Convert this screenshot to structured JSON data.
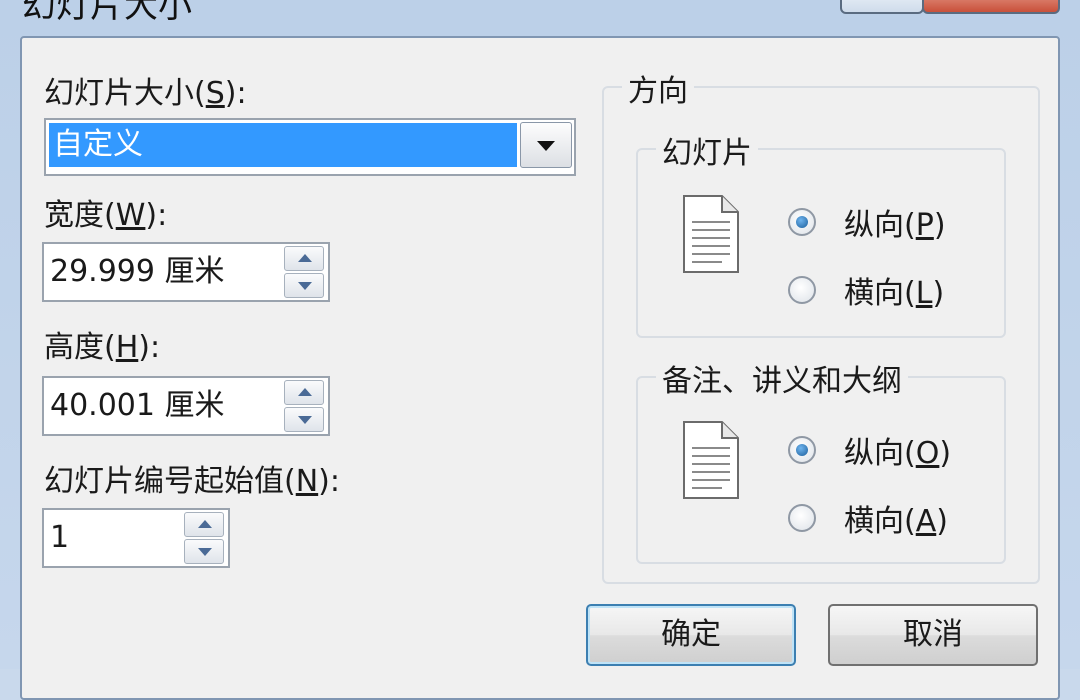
{
  "window": {
    "title": "幻灯片大小"
  },
  "slide_size": {
    "label_prefix": "幻灯片大小(",
    "label_key": "S",
    "label_suffix": "):",
    "selected": "自定义"
  },
  "width": {
    "label_prefix": "宽度(",
    "label_key": "W",
    "label_suffix": "):",
    "value": "29.999 厘米"
  },
  "height": {
    "label_prefix": "高度(",
    "label_key": "H",
    "label_suffix": "):",
    "value": "40.001 厘米"
  },
  "start_number": {
    "label_prefix": "幻灯片编号起始值(",
    "label_key": "N",
    "label_suffix": "):",
    "value": "1"
  },
  "orientation": {
    "title": "方向",
    "slides": {
      "title": "幻灯片",
      "portrait": {
        "prefix": "纵向(",
        "key": "P",
        "suffix": ")",
        "checked": true
      },
      "landscape": {
        "prefix": "横向(",
        "key": "L",
        "suffix": ")",
        "checked": false
      }
    },
    "notes": {
      "title": "备注、讲义和大纲",
      "portrait": {
        "prefix": "纵向(",
        "key": "O",
        "suffix": ")",
        "checked": true
      },
      "landscape": {
        "prefix": "横向(",
        "key": "A",
        "suffix": ")",
        "checked": false
      }
    }
  },
  "buttons": {
    "ok": "确定",
    "cancel": "取消"
  },
  "icons": {
    "dropdown": "chevron-down-icon",
    "spin_up": "arrow-up-icon",
    "spin_down": "arrow-down-icon",
    "document": "document-icon"
  }
}
